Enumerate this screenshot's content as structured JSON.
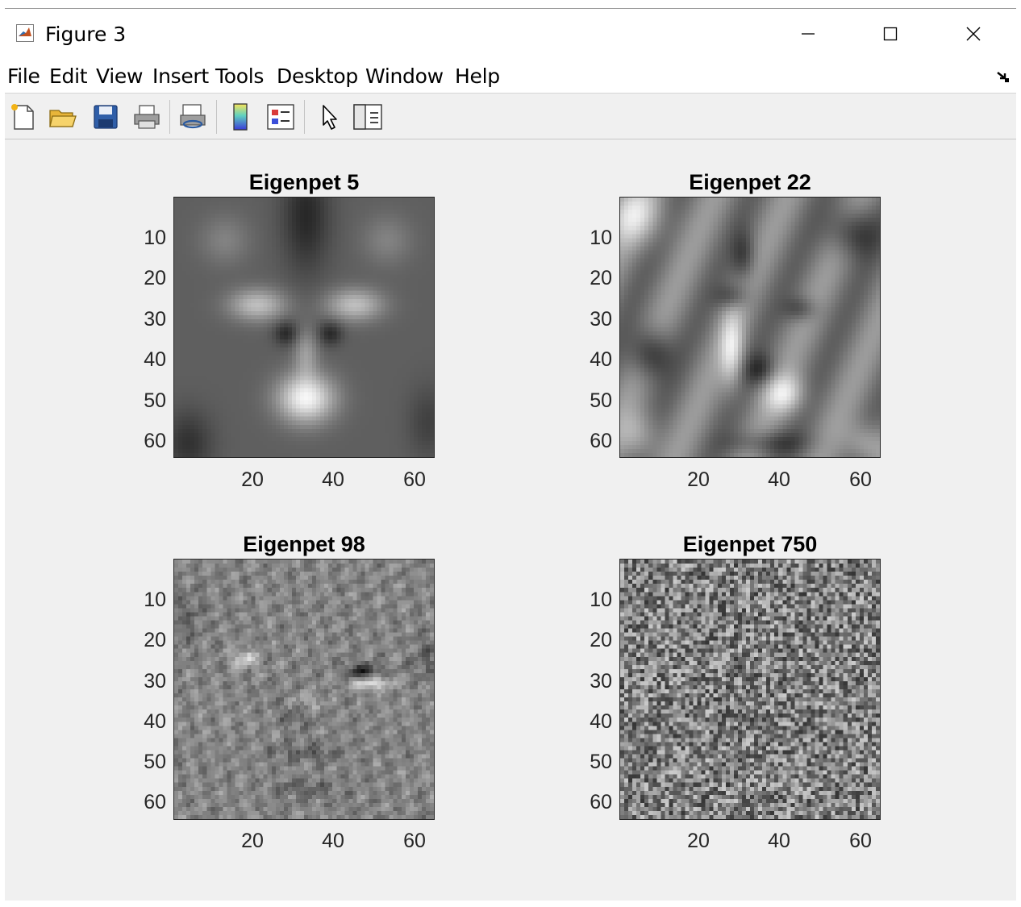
{
  "window": {
    "title": "Figure 3",
    "controls": {
      "minimize": "minimize",
      "maximize": "maximize",
      "close": "close"
    }
  },
  "menubar": {
    "items": [
      "File",
      "Edit",
      "View",
      "Insert",
      "Tools",
      "Desktop",
      "Window",
      "Help"
    ]
  },
  "toolbar": {
    "tools": [
      "new-figure-icon",
      "open-file-icon",
      "save-icon",
      "print-icon",
      "link-plot-icon",
      "insert-colorbar-icon",
      "insert-legend-icon",
      "edit-plot-arrow-icon",
      "property-inspector-icon"
    ]
  },
  "figure": {
    "subplots": [
      {
        "title": "Eigenpet 5",
        "pattern": "smooth-face"
      },
      {
        "title": "Eigenpet 22",
        "pattern": "blurred-face"
      },
      {
        "title": "Eigenpet 98",
        "pattern": "textured-face"
      },
      {
        "title": "Eigenpet 750",
        "pattern": "noise"
      }
    ],
    "yticks": [
      "10",
      "20",
      "30",
      "40",
      "50",
      "60"
    ],
    "xticks": [
      "20",
      "40",
      "60"
    ],
    "image_size": 64,
    "colormap": "gray"
  }
}
